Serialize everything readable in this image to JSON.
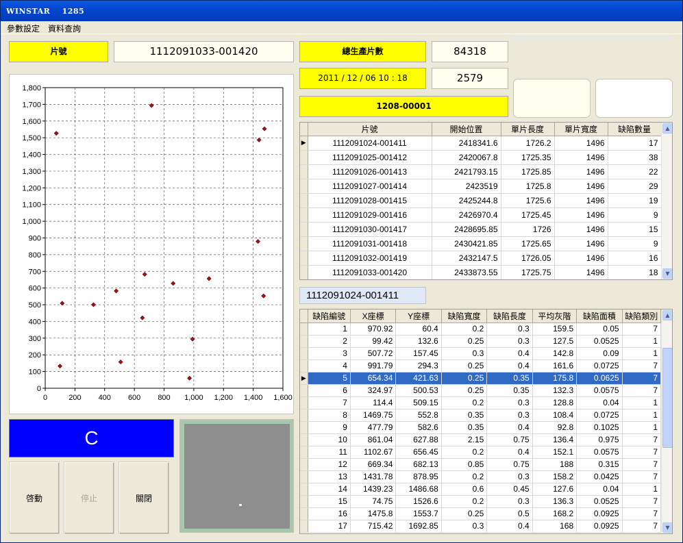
{
  "window": {
    "title": "WINSTAR    1285"
  },
  "menu": [
    "參數設定",
    "資料查詢"
  ],
  "header": {
    "piece_label": "片號",
    "piece_value": "1112091033-001420",
    "total_label": "總生產片數",
    "total_value": "84318",
    "datetime": "2011 / 12 / 06 10 : 18",
    "count_value": "2579",
    "batch": "1208-00001"
  },
  "grade": "C",
  "buttons": {
    "start": "啓動",
    "stop": "停止",
    "close": "關閉"
  },
  "chart_data": {
    "type": "scatter",
    "xlim": [
      0,
      1600
    ],
    "ylim": [
      0,
      1800
    ],
    "xticks": [
      "0",
      "200",
      "400",
      "600",
      "800",
      "1,000",
      "1,200",
      "1,400",
      "1,600"
    ],
    "yticks": [
      "0",
      "100",
      "200",
      "300",
      "400",
      "500",
      "600",
      "700",
      "800",
      "900",
      "1,000",
      "1,100",
      "1,200",
      "1,300",
      "1,400",
      "1,500",
      "1,600",
      "1,700",
      "1,800"
    ],
    "grid": true,
    "marker_color": "#b01010",
    "points": [
      [
        970.92,
        60.4
      ],
      [
        99.42,
        132.6
      ],
      [
        507.72,
        157.45
      ],
      [
        991.79,
        294.3
      ],
      [
        654.34,
        421.63
      ],
      [
        324.97,
        500.53
      ],
      [
        114.4,
        509.15
      ],
      [
        1469.75,
        552.8
      ],
      [
        477.79,
        582.6
      ],
      [
        861.04,
        627.88
      ],
      [
        1102.67,
        656.45
      ],
      [
        669.34,
        682.13
      ],
      [
        1431.78,
        878.95
      ],
      [
        1439.23,
        1486.68
      ],
      [
        74.75,
        1526.6
      ],
      [
        1475.8,
        1553.7
      ],
      [
        715.42,
        1692.85
      ]
    ]
  },
  "pieces_table": {
    "columns": [
      "片號",
      "開始位置",
      "單片長度",
      "單片寬度",
      "缺陷數量"
    ],
    "rows": [
      [
        "1112091024-001411",
        "2418341.6",
        "1726.2",
        "1496",
        "17"
      ],
      [
        "1112091025-001412",
        "2420067.8",
        "1725.35",
        "1496",
        "38"
      ],
      [
        "1112091026-001413",
        "2421793.15",
        "1725.85",
        "1496",
        "22"
      ],
      [
        "1112091027-001414",
        "2423519",
        "1725.8",
        "1496",
        "29"
      ],
      [
        "1112091028-001415",
        "2425244.8",
        "1725.6",
        "1496",
        "19"
      ],
      [
        "1112091029-001416",
        "2426970.4",
        "1725.45",
        "1496",
        "9"
      ],
      [
        "1112091030-001417",
        "2428695.85",
        "1726",
        "1496",
        "15"
      ],
      [
        "1112091031-001418",
        "2430421.85",
        "1725.65",
        "1496",
        "9"
      ],
      [
        "1112091032-001419",
        "2432147.5",
        "1726.05",
        "1496",
        "16"
      ],
      [
        "1112091033-001420",
        "2433873.55",
        "1725.75",
        "1496",
        "18"
      ]
    ]
  },
  "selected_piece": "1112091024-001411",
  "defects_table": {
    "columns": [
      "缺陷編號",
      "X座標",
      "Y座標",
      "缺陷寬度",
      "缺陷長度",
      "平均灰階",
      "缺陷面積",
      "缺陷類別"
    ],
    "selected_row": 4,
    "rows": [
      [
        "1",
        "970.92",
        "60.4",
        "0.2",
        "0.3",
        "159.5",
        "0.05",
        "7"
      ],
      [
        "2",
        "99.42",
        "132.6",
        "0.25",
        "0.3",
        "127.5",
        "0.0525",
        "1"
      ],
      [
        "3",
        "507.72",
        "157.45",
        "0.3",
        "0.4",
        "142.8",
        "0.09",
        "1"
      ],
      [
        "4",
        "991.79",
        "294.3",
        "0.25",
        "0.4",
        "161.6",
        "0.0725",
        "7"
      ],
      [
        "5",
        "654.34",
        "421.63",
        "0.25",
        "0.35",
        "175.8",
        "0.0625",
        "7"
      ],
      [
        "6",
        "324.97",
        "500.53",
        "0.25",
        "0.35",
        "132.3",
        "0.0575",
        "7"
      ],
      [
        "7",
        "114.4",
        "509.15",
        "0.2",
        "0.3",
        "128.8",
        "0.04",
        "1"
      ],
      [
        "8",
        "1469.75",
        "552.8",
        "0.35",
        "0.3",
        "108.4",
        "0.0725",
        "1"
      ],
      [
        "9",
        "477.79",
        "582.6",
        "0.35",
        "0.4",
        "92.8",
        "0.1025",
        "1"
      ],
      [
        "10",
        "861.04",
        "627.88",
        "2.15",
        "0.75",
        "136.4",
        "0.975",
        "7"
      ],
      [
        "11",
        "1102.67",
        "656.45",
        "0.2",
        "0.4",
        "152.1",
        "0.0575",
        "7"
      ],
      [
        "12",
        "669.34",
        "682.13",
        "0.85",
        "0.75",
        "188",
        "0.315",
        "7"
      ],
      [
        "13",
        "1431.78",
        "878.95",
        "0.2",
        "0.3",
        "158.2",
        "0.0425",
        "7"
      ],
      [
        "14",
        "1439.23",
        "1486.68",
        "0.6",
        "0.45",
        "127.6",
        "0.04",
        "1"
      ],
      [
        "15",
        "74.75",
        "1526.6",
        "0.2",
        "0.3",
        "136.3",
        "0.0525",
        "7"
      ],
      [
        "16",
        "1475.8",
        "1553.7",
        "0.25",
        "0.5",
        "168.2",
        "0.0925",
        "7"
      ],
      [
        "17",
        "715.42",
        "1692.85",
        "0.3",
        "0.4",
        "168",
        "0.0925",
        "7"
      ]
    ]
  }
}
